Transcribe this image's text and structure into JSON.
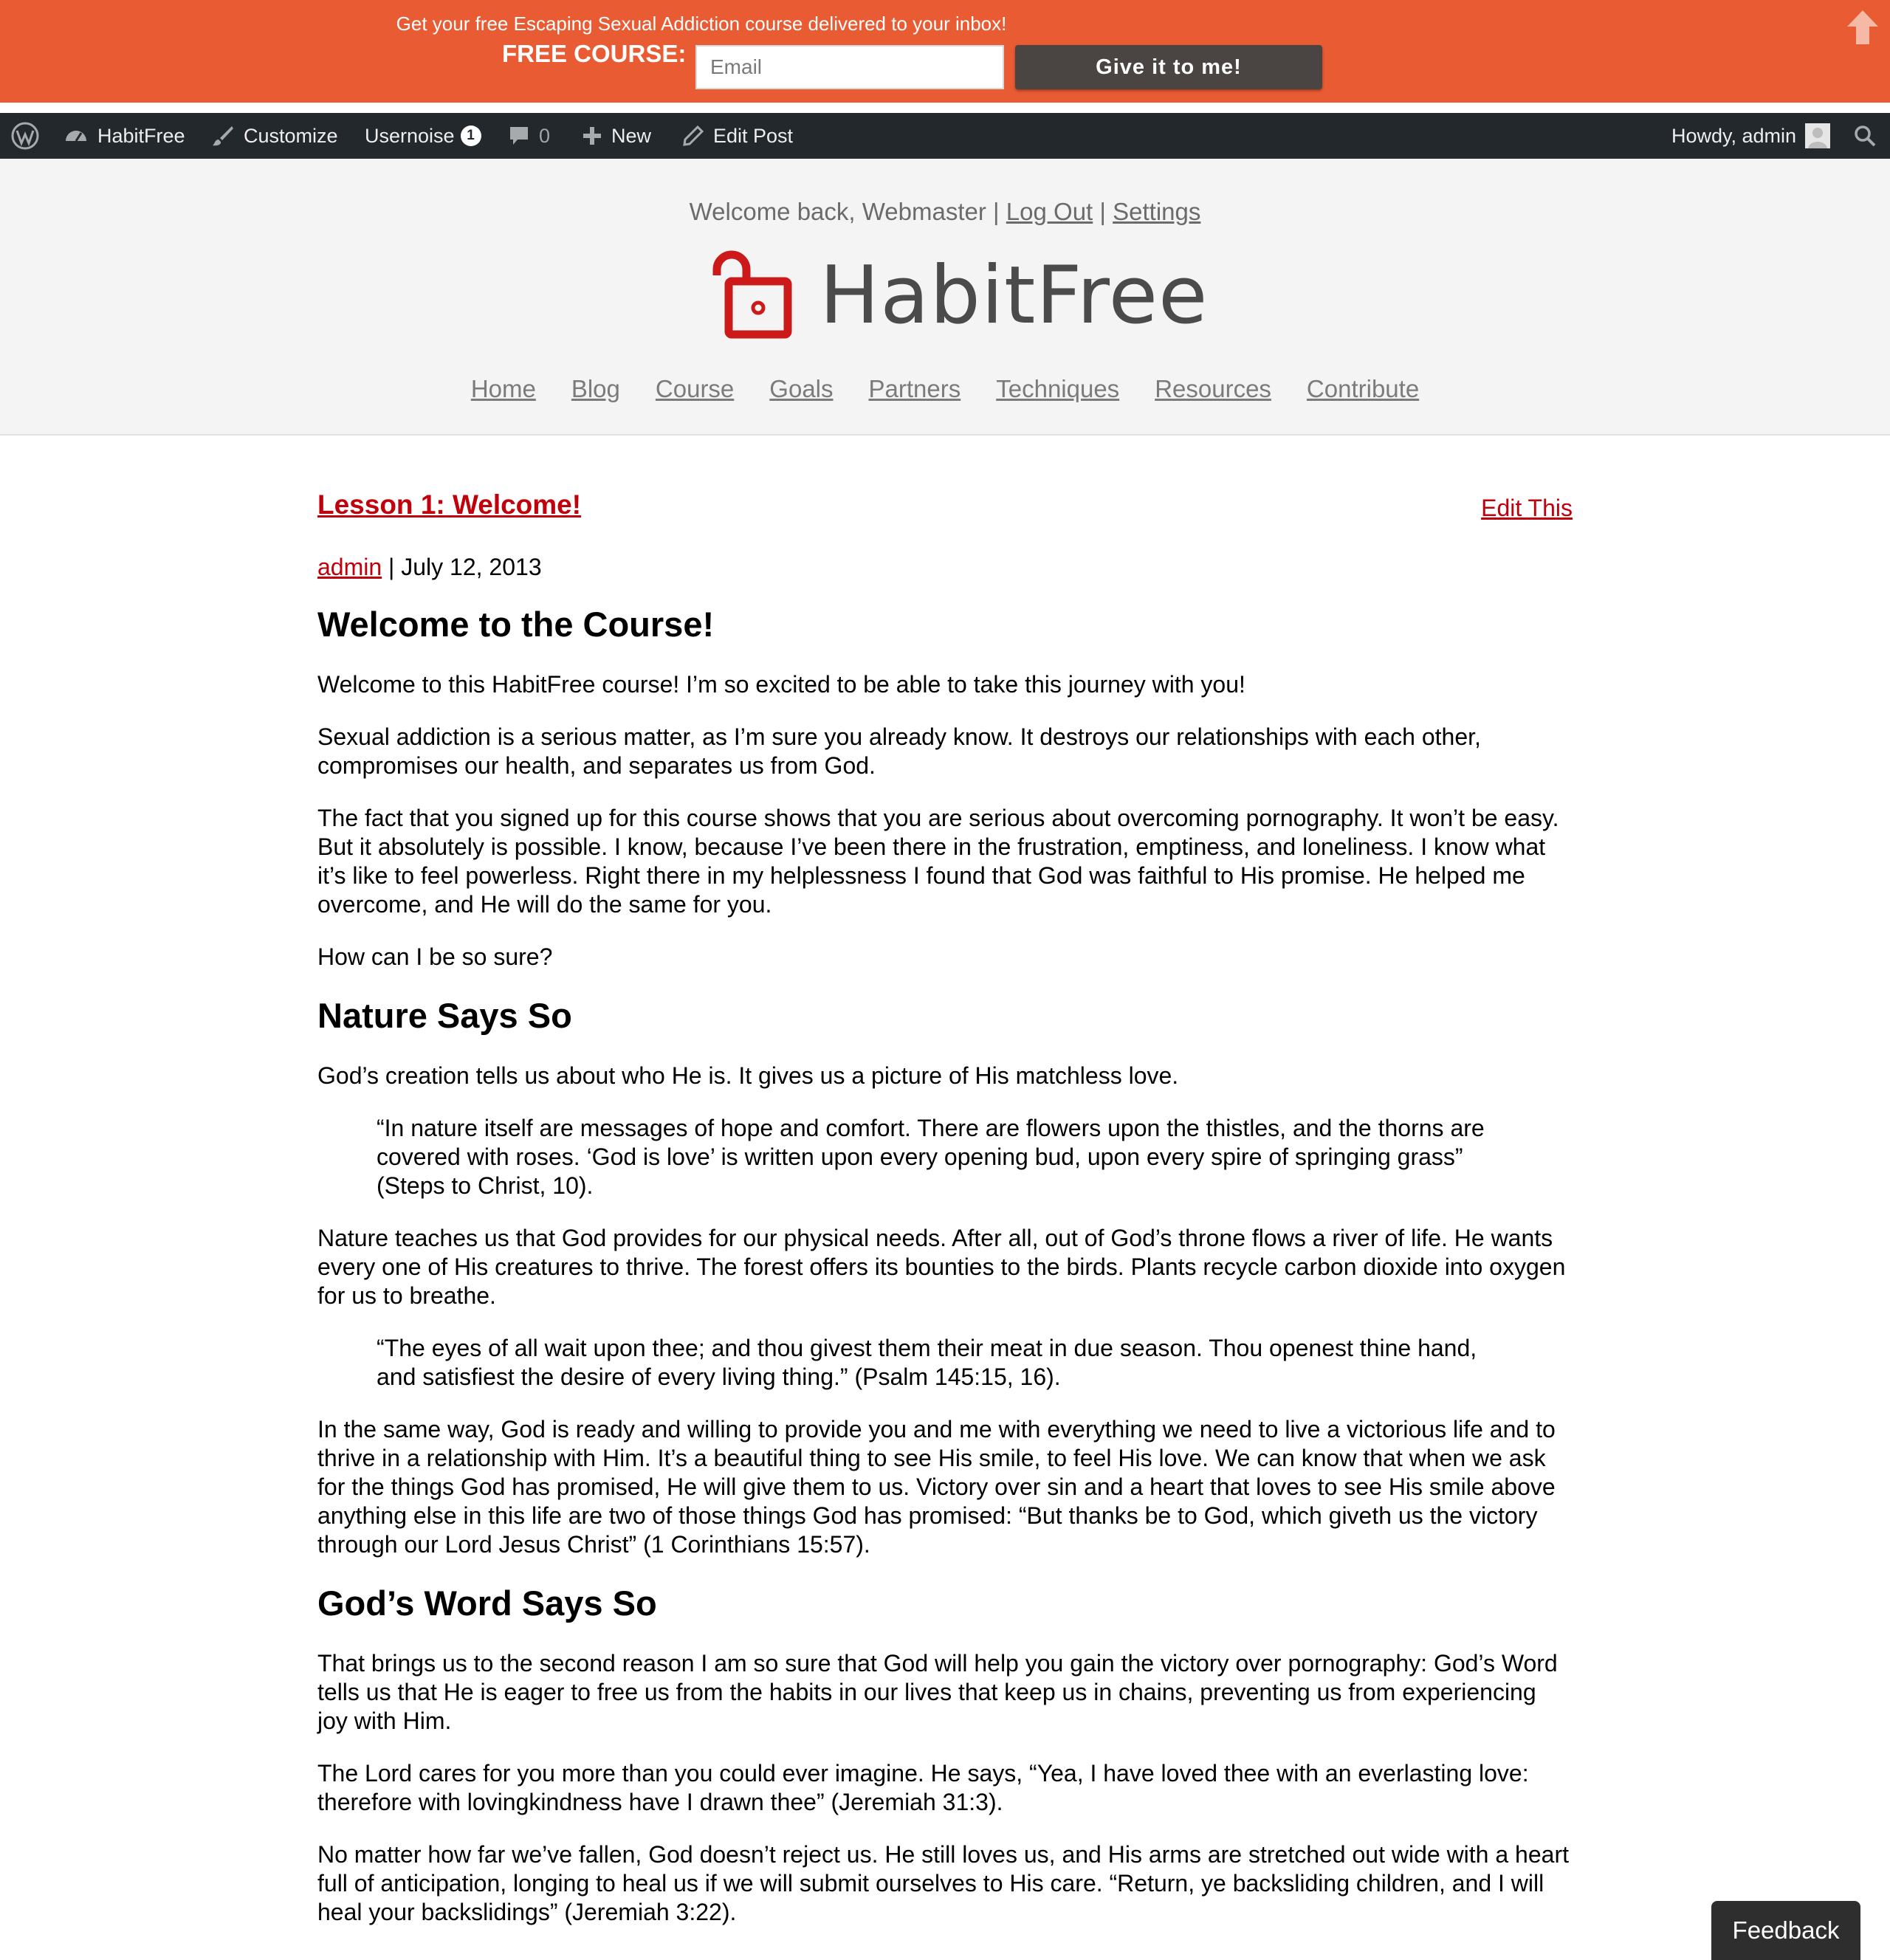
{
  "promo": {
    "message": "Get your free Escaping Sexual Addiction course delivered to your inbox!",
    "label": "FREE COURSE:",
    "email_placeholder": "Email",
    "button": "Give it to me!"
  },
  "adminbar": {
    "site": "HabitFree",
    "customize": "Customize",
    "usernoise": "Usernoise",
    "usernoise_count": "1",
    "comments_count": "0",
    "new": "New",
    "edit_post": "Edit Post",
    "howdy": "Howdy, admin"
  },
  "header": {
    "welcome": "Welcome back, Webmaster",
    "sep": "|",
    "logout": "Log Out",
    "settings": "Settings",
    "logo_text": "HabitFree",
    "nav": [
      "Home",
      "Blog",
      "Course",
      "Goals",
      "Partners",
      "Techniques",
      "Resources",
      "Contribute"
    ]
  },
  "post": {
    "title": "Lesson 1: Welcome!",
    "edit": "Edit This",
    "author": "admin",
    "date": "| July 12, 2013",
    "h_welcome": "Welcome to the Course!",
    "p1": "Welcome to this HabitFree course! I’m so excited to be able to take this journey with you!",
    "p2": "Sexual addiction is a serious matter, as I’m sure you already know. It destroys our relationships with each other, compromises our health, and separates us from God.",
    "p3": "The fact that you signed up for this course shows that you are serious about overcoming pornography. It won’t be easy. But it absolutely is possible. I know, because I’ve been there in the frustration, emptiness, and loneliness. I know what it’s like to feel powerless. Right there in my helplessness I found that God was faithful to His promise. He helped me overcome, and He will do the same for you.",
    "p4": "How can I be so sure?",
    "h_nature": "Nature Says So",
    "p5": "God’s creation tells us about who He is. It gives us a picture of His matchless love.",
    "q1": "“In nature itself are messages of hope and comfort. There are flowers upon the thistles, and the thorns are covered with roses. ‘God is love’ is written upon every opening bud, upon every spire of springing grass” (Steps to Christ, 10).",
    "p6": "Nature teaches us that God provides for our physical needs. After all, out of God’s throne flows a river of life. He wants every one of His creatures to thrive. The forest offers its bounties to the birds. Plants recycle carbon dioxide into oxygen for us to breathe.",
    "q2": "“The eyes of all wait upon thee; and thou givest them their meat in due season. Thou openest thine hand, and satisfiest the desire of every living thing.” (Psalm 145:15, 16).",
    "p7": "In the same way, God is ready and willing to provide you and me with everything we need to live a victorious life and to thrive in a relationship with Him. It’s a beautiful thing to see His smile, to feel His love. We can know that when we ask for the things God has promised, He will give them to us. Victory over sin and a heart that loves to see His smile above anything else in this life are two of those things God has promised: “But thanks be to God, which giveth us the victory through our Lord Jesus Christ” (1 Corinthians 15:57).",
    "h_word": "God’s Word Says So",
    "p8": "That brings us to the second reason I am so sure that God will help you gain the victory over pornography: God’s Word tells us that He is eager to free us from the habits in our lives that keep us in chains, preventing us from experiencing joy with Him.",
    "p9": "The Lord cares for you more than you could ever imagine. He says, “Yea, I have loved thee with an everlasting love: therefore with lovingkindness have I drawn thee” (Jeremiah 31:3).",
    "p10": "No matter how far we’ve fallen, God doesn’t reject us. He still loves us, and His arms are stretched out wide with a heart full of anticipation, longing to heal us if we will submit ourselves to His care. “Return, ye backsliding children, and I will heal your backslidings” (Jeremiah 3:22)."
  },
  "feedback": "Feedback",
  "colors": {
    "promo": "#e95b32",
    "adminbar": "#23282d",
    "accent": "#c0000b"
  }
}
